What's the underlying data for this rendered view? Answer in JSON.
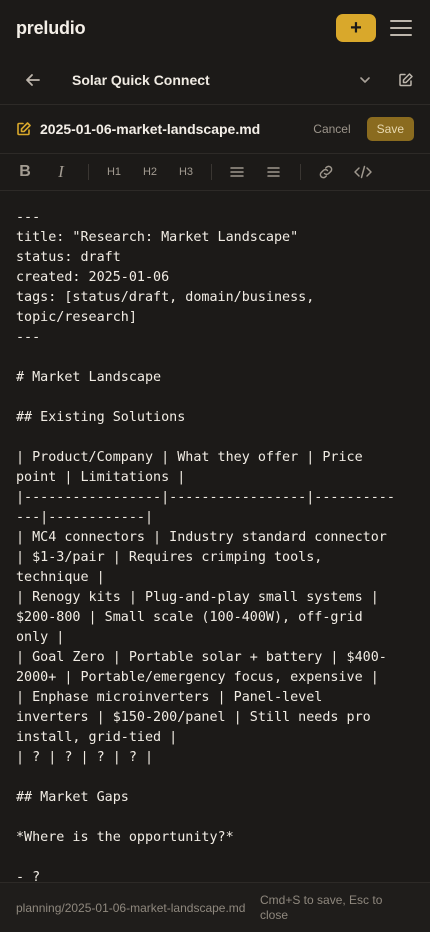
{
  "app": {
    "title": "preludio",
    "add_label": "+"
  },
  "project": {
    "title": "Solar Quick Connect"
  },
  "file": {
    "name": "2025-01-06-market-landscape.md",
    "cancel_label": "Cancel",
    "save_label": "Save"
  },
  "toolbar": {
    "bold": "B",
    "italic": "I",
    "h1": "H1",
    "h2": "H2",
    "h3": "H3"
  },
  "editor": {
    "lines": [
      "---",
      "title: \"Research: Market Landscape\"",
      "status: draft",
      "created: 2025-01-06",
      "tags: [status/draft, domain/business,",
      "topic/research]",
      "---",
      "",
      "# Market Landscape",
      "",
      "## Existing Solutions",
      "",
      "| Product/Company | What they offer | Price",
      "point | Limitations |",
      "|-----------------|-----------------|----------",
      "---|------------|",
      "| MC4 connectors | Industry standard connector",
      "| $1-3/pair | Requires crimping tools,",
      "technique |",
      "| Renogy kits | Plug-and-play small systems |",
      "$200-800 | Small scale (100-400W), off-grid",
      "only |",
      "| Goal Zero | Portable solar + battery | $400-",
      "2000+ | Portable/emergency focus, expensive |",
      "| Enphase microinverters | Panel-level",
      "inverters | $150-200/panel | Still needs pro",
      "install, grid-tied |",
      "| ? | ? | ? | ? |",
      "",
      "## Market Gaps",
      "",
      "*Where is the opportunity?*",
      "",
      "- ?"
    ]
  },
  "status": {
    "path": "planning/2025-01-06-market-landscape.md",
    "hint": "Cmd+S to save, Esc to close"
  }
}
